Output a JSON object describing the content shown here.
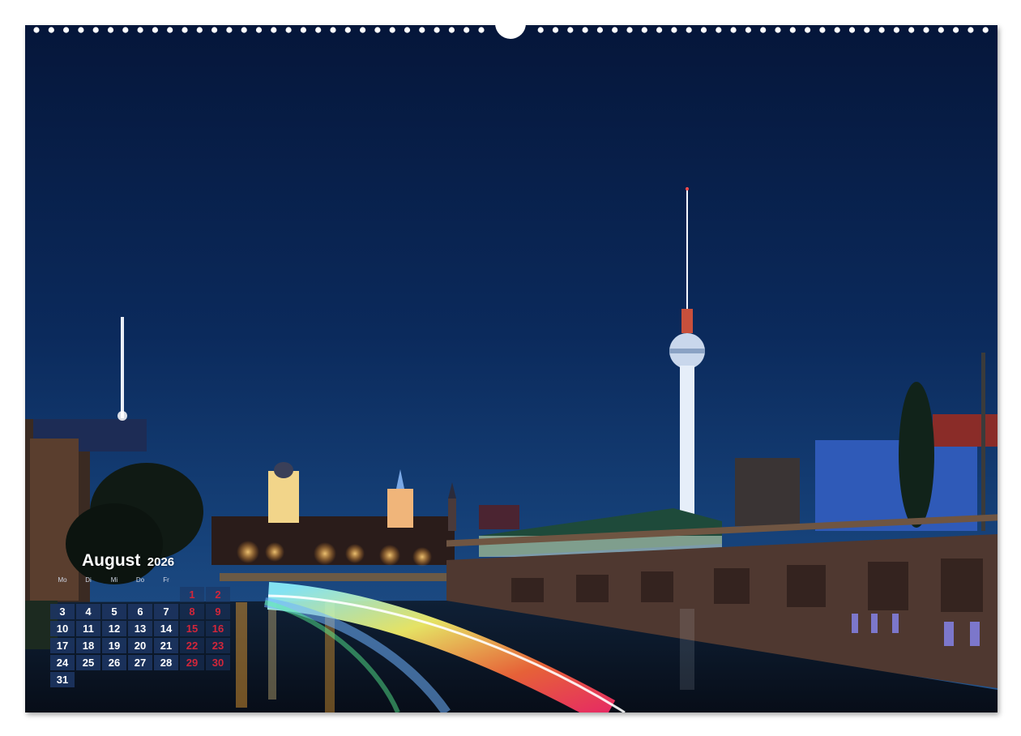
{
  "calendar": {
    "month": "August",
    "year": "2026",
    "weekday_headers": [
      "Mo",
      "Di",
      "Mi",
      "Do",
      "Fr"
    ],
    "weeks": [
      [
        "",
        "",
        "",
        "",
        "",
        "1",
        "2"
      ],
      [
        "3",
        "4",
        "5",
        "6",
        "7",
        "8",
        "9"
      ],
      [
        "10",
        "11",
        "12",
        "13",
        "14",
        "15",
        "16"
      ],
      [
        "17",
        "18",
        "19",
        "20",
        "21",
        "22",
        "23"
      ],
      [
        "24",
        "25",
        "26",
        "27",
        "28",
        "29",
        "30"
      ],
      [
        "31",
        "",
        "",
        "",
        "",
        "",
        ""
      ]
    ]
  },
  "photo": {
    "subject": "Berlin skyline at night with TV tower, Spree river and light trails",
    "colors": {
      "sky_top": "#061a3e",
      "sky_bottom": "#1c4e86",
      "weekday_cell": "#1c3460",
      "weekend_text": "#d3263a"
    }
  }
}
